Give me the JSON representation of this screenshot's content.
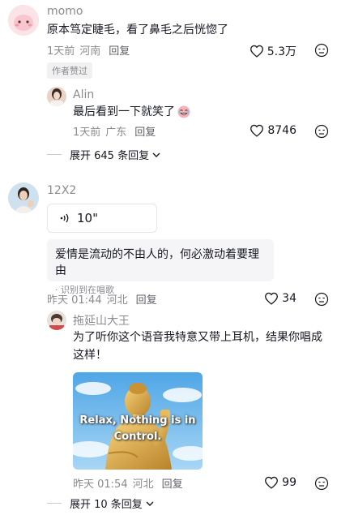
{
  "comments": [
    {
      "username": "momo",
      "text": "原本笃定睫毛，看了鼻毛之后恍惚了",
      "time": "1天前",
      "location": "河南",
      "reply_label": "回复",
      "likes": "5.3万",
      "badge": "作者赞过",
      "replies": [
        {
          "username": "Alin",
          "text": "最后看到一下就笑了",
          "time": "1天前",
          "location": "广东",
          "reply_label": "回复",
          "likes": "8746"
        }
      ],
      "expand_label": "展开 645 条回复"
    },
    {
      "username": "12X2",
      "voice_duration": "10\"",
      "lyric": "爱情是流动的不由人的，何必激动着要理由",
      "lyric_note": "识别到在唱歌",
      "time": "昨天 01:44",
      "location": "河北",
      "reply_label": "回复",
      "likes": "34",
      "replies": [
        {
          "username": "拖延山大王",
          "text_line1": "为了听你这个语音我特意又带上耳机，结果你唱成",
          "text_line2": "这样！",
          "image_caption_line1": "Relax, Nothing is in",
          "image_caption_line2": "Control.",
          "time": "昨天 01:54",
          "location": "河北",
          "reply_label": "回复",
          "likes": "99"
        }
      ],
      "expand_label": "展开 10 条回复"
    }
  ],
  "icons": {
    "like": "heart-outline-icon",
    "dislike": "dislike-face-icon",
    "expand": "chevron-down-icon",
    "voice": "voice-wave-icon"
  },
  "colors": {
    "text": "#161823",
    "meta": "#8a8b91",
    "sky": "#6cb6ec",
    "gold": "#d9a43a"
  }
}
